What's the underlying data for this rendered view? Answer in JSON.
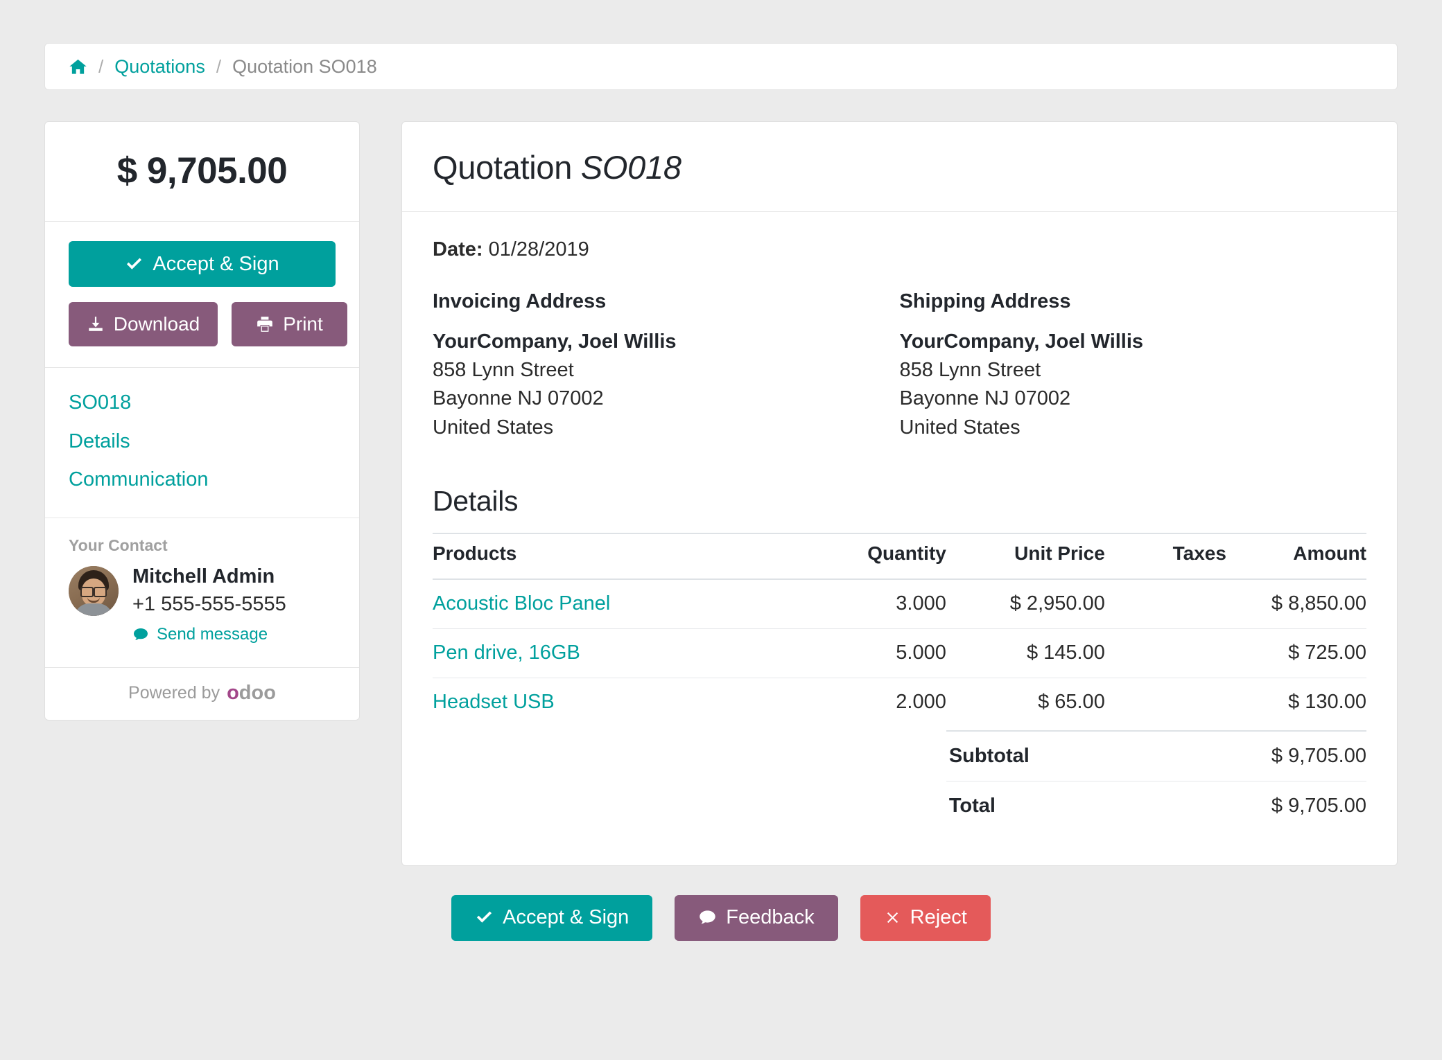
{
  "breadcrumb": {
    "home_icon": "home-icon",
    "separator": "/",
    "link_label": "Quotations",
    "current_label": "Quotation SO018"
  },
  "sidebar": {
    "amount_total": "$ 9,705.00",
    "accept_label": "Accept & Sign",
    "download_label": "Download",
    "print_label": "Print",
    "links": [
      {
        "label": "SO018"
      },
      {
        "label": "Details"
      },
      {
        "label": "Communication"
      }
    ],
    "contact": {
      "section_label": "Your Contact",
      "name": "Mitchell Admin",
      "phone": "+1 555-555-5555",
      "send_message_label": "Send message"
    },
    "powered_by": {
      "text": "Powered by",
      "brand_first": "o",
      "brand_rest": "doo"
    }
  },
  "main": {
    "title_prefix": "Quotation ",
    "title_ref": "SO018",
    "date_label": "Date:",
    "date_value": "01/28/2019",
    "invoicing": {
      "title": "Invoicing Address",
      "name": "YourCompany, Joel Willis",
      "street": "858 Lynn Street",
      "city": "Bayonne NJ 07002",
      "country": "United States"
    },
    "shipping": {
      "title": "Shipping Address",
      "name": "YourCompany, Joel Willis",
      "street": "858 Lynn Street",
      "city": "Bayonne NJ 07002",
      "country": "United States"
    },
    "details_heading": "Details",
    "table": {
      "headers": {
        "products": "Products",
        "quantity": "Quantity",
        "unit_price": "Unit Price",
        "taxes": "Taxes",
        "amount": "Amount"
      },
      "rows": [
        {
          "product": "Acoustic Bloc Panel",
          "quantity": "3.000",
          "unit_price": "$ 2,950.00",
          "taxes": "",
          "amount": "$ 8,850.00"
        },
        {
          "product": "Pen drive, 16GB",
          "quantity": "5.000",
          "unit_price": "$ 145.00",
          "taxes": "",
          "amount": "$ 725.00"
        },
        {
          "product": "Headset USB",
          "quantity": "2.000",
          "unit_price": "$ 65.00",
          "taxes": "",
          "amount": "$ 130.00"
        }
      ],
      "subtotal_label": "Subtotal",
      "subtotal_value": "$ 9,705.00",
      "total_label": "Total",
      "total_value": "$ 9,705.00"
    }
  },
  "footer": {
    "accept_label": "Accept & Sign",
    "feedback_label": "Feedback",
    "reject_label": "Reject"
  },
  "colors": {
    "accent_teal": "#00a09d",
    "purple": "#875a7b",
    "danger_red": "#e45a5a",
    "page_bg": "#ebebeb",
    "odoo_brand": "#a24689"
  }
}
